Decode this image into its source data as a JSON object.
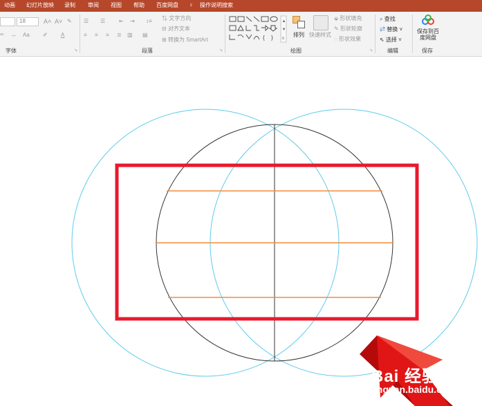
{
  "menu": {
    "tabs": [
      "动画",
      "幻灯片放映",
      "录制",
      "审阅",
      "视图",
      "帮助",
      "百度网盘"
    ],
    "search_label": "操作说明搜索"
  },
  "ribbon": {
    "font_size_value": "18",
    "text_direction": "文字方向",
    "align_text": "对齐文本",
    "convert_smartart": "转换为 SmartArt",
    "arrange": "排列",
    "quick_styles": "快速样式",
    "shape_fill": "形状填充",
    "shape_outline": "形状轮廓",
    "shape_effects": "形状效果",
    "find": "查找",
    "replace": "替换",
    "select": "选择",
    "save_to_baidu": "保存到百度网盘",
    "groups": {
      "font": "字体",
      "paragraph": "段落",
      "drawing": "绘图",
      "editing": "编辑",
      "save": "保存"
    }
  },
  "watermark": {
    "brand": "Bai 经验",
    "site": "jingyan.baidu.com"
  },
  "colors": {
    "accent": "#b7472a",
    "highlight_rect": "#e8192c",
    "guide_circle": "#5ecbea",
    "globe_outline": "#333333",
    "latitude_line": "#f28c3b"
  }
}
